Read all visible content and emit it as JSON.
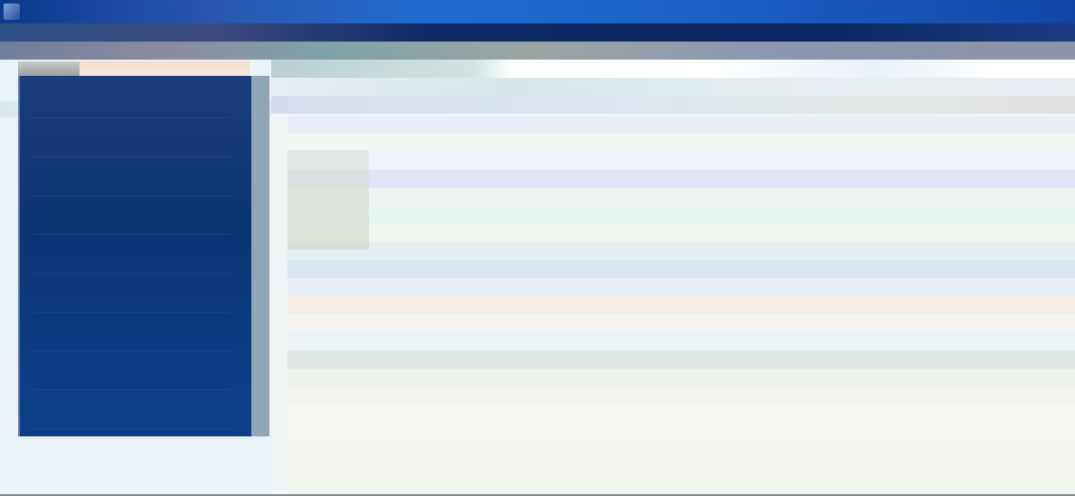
{
  "window": {
    "title": "",
    "accent_color": "#1f6bd0"
  },
  "icons": {
    "app": "app-icon",
    "avatar": "avatar-image"
  },
  "sidebar": {
    "items": [
      {
        "label": ""
      },
      {
        "label": ""
      },
      {
        "label": ""
      },
      {
        "label": ""
      },
      {
        "label": ""
      },
      {
        "label": ""
      },
      {
        "label": ""
      },
      {
        "label": ""
      },
      {
        "label": ""
      }
    ]
  },
  "main": {
    "header": "",
    "subheader": "",
    "filter": "",
    "rows": [
      {
        "text": "",
        "tint": "#e7eef8"
      },
      {
        "text": "",
        "tint": "#f2f7f2"
      },
      {
        "text": "",
        "tint": "#eef3fb"
      },
      {
        "text": "",
        "tint": "#e3e3f6"
      },
      {
        "text": "",
        "tint": "#eef2f0"
      },
      {
        "text": "",
        "tint": "#e7f3f0"
      },
      {
        "text": "",
        "tint": "#eef6ea"
      },
      {
        "text": "",
        "tint": "#e3eef0"
      },
      {
        "text": "",
        "tint": "#d9e6f3"
      },
      {
        "text": "",
        "tint": "#e9eef6"
      },
      {
        "text": "",
        "tint": "#f5ece2"
      },
      {
        "text": "",
        "tint": "#f3f4f0"
      },
      {
        "text": "",
        "tint": "#e9f2f4"
      },
      {
        "text": "",
        "tint": "#dde6e4"
      },
      {
        "text": "",
        "tint": "#edf1ea"
      },
      {
        "text": "",
        "tint": "#f2f5ee"
      },
      {
        "text": "",
        "tint": "#f6f8f1"
      },
      {
        "text": "",
        "tint": "#f6f8f1"
      },
      {
        "text": "",
        "tint": "#f3f6ee"
      },
      {
        "text": "",
        "tint": "#f3f6ee"
      },
      {
        "text": "",
        "tint": "#f1f5ec"
      }
    ]
  }
}
